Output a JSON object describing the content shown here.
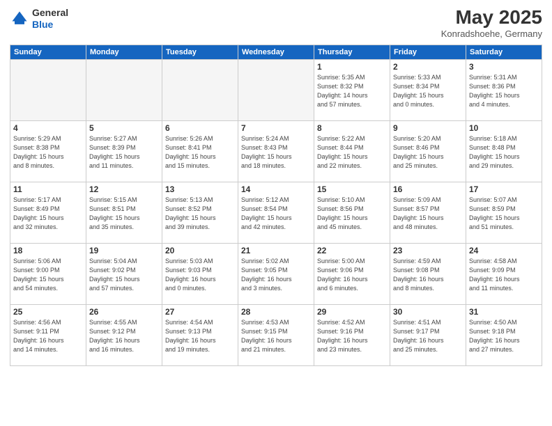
{
  "header": {
    "logo_line1": "General",
    "logo_line2": "Blue",
    "month": "May 2025",
    "location": "Konradshoehe, Germany"
  },
  "weekdays": [
    "Sunday",
    "Monday",
    "Tuesday",
    "Wednesday",
    "Thursday",
    "Friday",
    "Saturday"
  ],
  "weeks": [
    [
      {
        "day": "",
        "info": ""
      },
      {
        "day": "",
        "info": ""
      },
      {
        "day": "",
        "info": ""
      },
      {
        "day": "",
        "info": ""
      },
      {
        "day": "1",
        "info": "Sunrise: 5:35 AM\nSunset: 8:32 PM\nDaylight: 14 hours\nand 57 minutes."
      },
      {
        "day": "2",
        "info": "Sunrise: 5:33 AM\nSunset: 8:34 PM\nDaylight: 15 hours\nand 0 minutes."
      },
      {
        "day": "3",
        "info": "Sunrise: 5:31 AM\nSunset: 8:36 PM\nDaylight: 15 hours\nand 4 minutes."
      }
    ],
    [
      {
        "day": "4",
        "info": "Sunrise: 5:29 AM\nSunset: 8:38 PM\nDaylight: 15 hours\nand 8 minutes."
      },
      {
        "day": "5",
        "info": "Sunrise: 5:27 AM\nSunset: 8:39 PM\nDaylight: 15 hours\nand 11 minutes."
      },
      {
        "day": "6",
        "info": "Sunrise: 5:26 AM\nSunset: 8:41 PM\nDaylight: 15 hours\nand 15 minutes."
      },
      {
        "day": "7",
        "info": "Sunrise: 5:24 AM\nSunset: 8:43 PM\nDaylight: 15 hours\nand 18 minutes."
      },
      {
        "day": "8",
        "info": "Sunrise: 5:22 AM\nSunset: 8:44 PM\nDaylight: 15 hours\nand 22 minutes."
      },
      {
        "day": "9",
        "info": "Sunrise: 5:20 AM\nSunset: 8:46 PM\nDaylight: 15 hours\nand 25 minutes."
      },
      {
        "day": "10",
        "info": "Sunrise: 5:18 AM\nSunset: 8:48 PM\nDaylight: 15 hours\nand 29 minutes."
      }
    ],
    [
      {
        "day": "11",
        "info": "Sunrise: 5:17 AM\nSunset: 8:49 PM\nDaylight: 15 hours\nand 32 minutes."
      },
      {
        "day": "12",
        "info": "Sunrise: 5:15 AM\nSunset: 8:51 PM\nDaylight: 15 hours\nand 35 minutes."
      },
      {
        "day": "13",
        "info": "Sunrise: 5:13 AM\nSunset: 8:52 PM\nDaylight: 15 hours\nand 39 minutes."
      },
      {
        "day": "14",
        "info": "Sunrise: 5:12 AM\nSunset: 8:54 PM\nDaylight: 15 hours\nand 42 minutes."
      },
      {
        "day": "15",
        "info": "Sunrise: 5:10 AM\nSunset: 8:56 PM\nDaylight: 15 hours\nand 45 minutes."
      },
      {
        "day": "16",
        "info": "Sunrise: 5:09 AM\nSunset: 8:57 PM\nDaylight: 15 hours\nand 48 minutes."
      },
      {
        "day": "17",
        "info": "Sunrise: 5:07 AM\nSunset: 8:59 PM\nDaylight: 15 hours\nand 51 minutes."
      }
    ],
    [
      {
        "day": "18",
        "info": "Sunrise: 5:06 AM\nSunset: 9:00 PM\nDaylight: 15 hours\nand 54 minutes."
      },
      {
        "day": "19",
        "info": "Sunrise: 5:04 AM\nSunset: 9:02 PM\nDaylight: 15 hours\nand 57 minutes."
      },
      {
        "day": "20",
        "info": "Sunrise: 5:03 AM\nSunset: 9:03 PM\nDaylight: 16 hours\nand 0 minutes."
      },
      {
        "day": "21",
        "info": "Sunrise: 5:02 AM\nSunset: 9:05 PM\nDaylight: 16 hours\nand 3 minutes."
      },
      {
        "day": "22",
        "info": "Sunrise: 5:00 AM\nSunset: 9:06 PM\nDaylight: 16 hours\nand 6 minutes."
      },
      {
        "day": "23",
        "info": "Sunrise: 4:59 AM\nSunset: 9:08 PM\nDaylight: 16 hours\nand 8 minutes."
      },
      {
        "day": "24",
        "info": "Sunrise: 4:58 AM\nSunset: 9:09 PM\nDaylight: 16 hours\nand 11 minutes."
      }
    ],
    [
      {
        "day": "25",
        "info": "Sunrise: 4:56 AM\nSunset: 9:11 PM\nDaylight: 16 hours\nand 14 minutes."
      },
      {
        "day": "26",
        "info": "Sunrise: 4:55 AM\nSunset: 9:12 PM\nDaylight: 16 hours\nand 16 minutes."
      },
      {
        "day": "27",
        "info": "Sunrise: 4:54 AM\nSunset: 9:13 PM\nDaylight: 16 hours\nand 19 minutes."
      },
      {
        "day": "28",
        "info": "Sunrise: 4:53 AM\nSunset: 9:15 PM\nDaylight: 16 hours\nand 21 minutes."
      },
      {
        "day": "29",
        "info": "Sunrise: 4:52 AM\nSunset: 9:16 PM\nDaylight: 16 hours\nand 23 minutes."
      },
      {
        "day": "30",
        "info": "Sunrise: 4:51 AM\nSunset: 9:17 PM\nDaylight: 16 hours\nand 25 minutes."
      },
      {
        "day": "31",
        "info": "Sunrise: 4:50 AM\nSunset: 9:18 PM\nDaylight: 16 hours\nand 27 minutes."
      }
    ]
  ]
}
